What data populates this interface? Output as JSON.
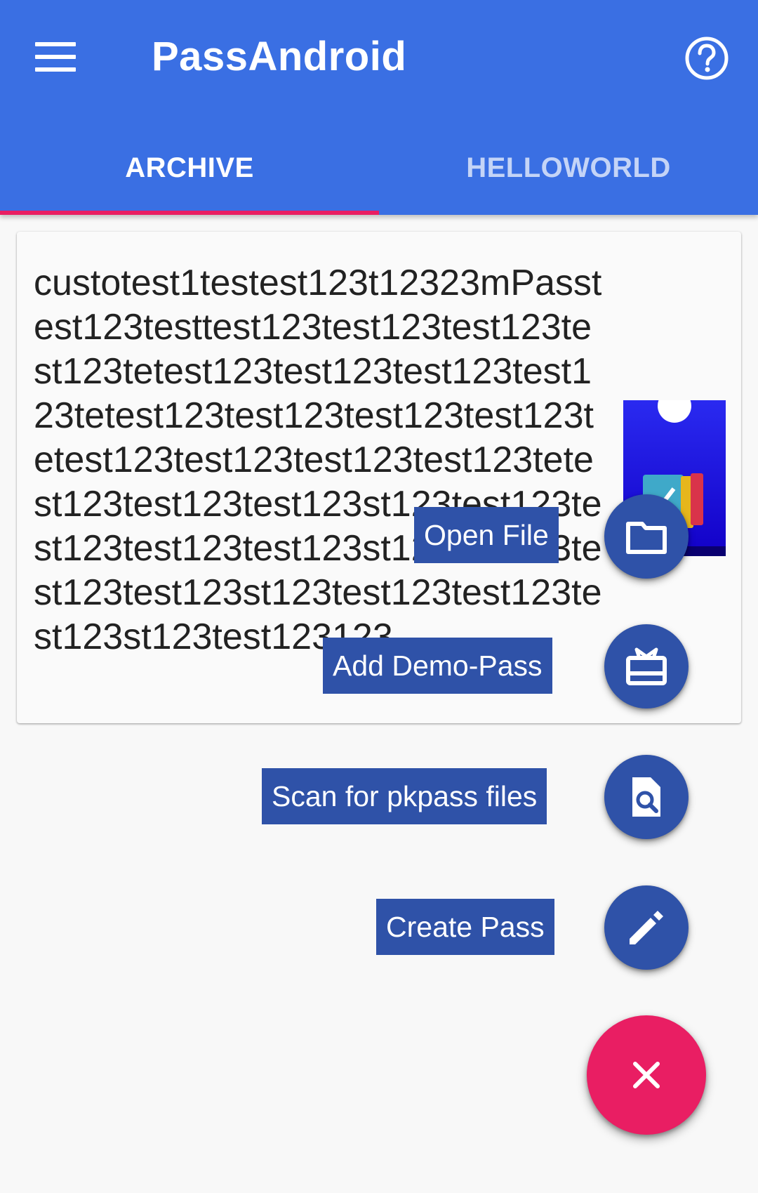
{
  "app_bar": {
    "title": "PassAndroid",
    "menu_icon": "hamburger-menu-icon",
    "help_icon": "help-circle-icon",
    "color": "#3a6fe3"
  },
  "tabs": [
    {
      "label": "ARCHIVE",
      "active": true
    },
    {
      "label": "HELLOWORLD",
      "active": false
    }
  ],
  "tab_indicator_color": "#e91e63",
  "pass_card": {
    "description": "custotest1testest123t12323mPasstest123testtest123test123test123test123tetest123test123test123test123tetest123test123test123test123tetest123test123test123test123tetest123test123test123st123test123test123test123test123st123test123test123test123st123test123test123test123st123test123123",
    "thumbnail_icon": "pass-ticket-thumbnail"
  },
  "fab_menu": {
    "items": [
      {
        "label": "Open File",
        "icon": "folder-icon"
      },
      {
        "label": "Add Demo-Pass",
        "icon": "gift-card-icon"
      },
      {
        "label": "Scan for pkpass files",
        "icon": "file-search-icon"
      },
      {
        "label": "Create Pass",
        "icon": "pencil-icon"
      }
    ],
    "close_icon": "close-icon",
    "mini_fab_color": "#2f52a8",
    "main_fab_color": "#e91e63"
  }
}
